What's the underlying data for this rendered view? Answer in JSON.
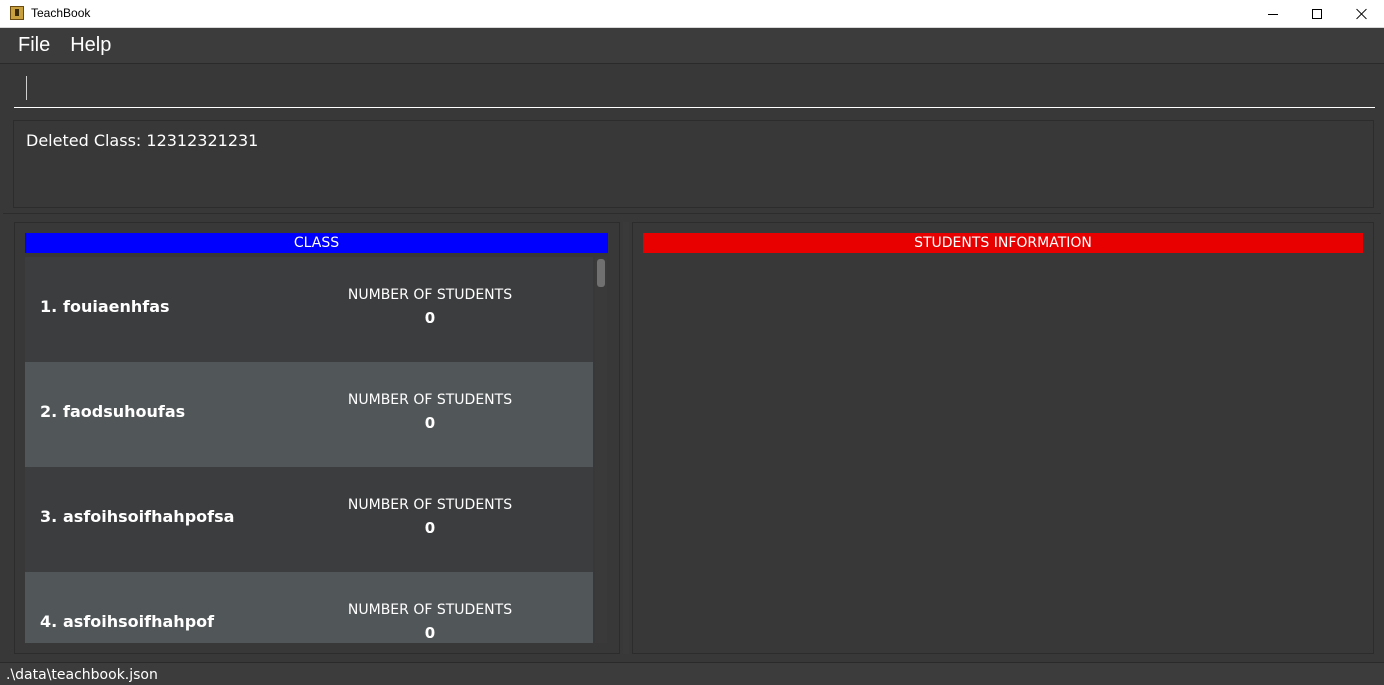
{
  "window": {
    "title": "TeachBook"
  },
  "menu": {
    "items": [
      {
        "label": "File"
      },
      {
        "label": "Help"
      }
    ]
  },
  "command": {
    "value": "",
    "placeholder": ""
  },
  "result": {
    "text": "Deleted Class: 12312321231"
  },
  "class_panel": {
    "header": "CLASS",
    "header_color": "#0000ff",
    "rows": [
      {
        "index": "1.",
        "name": "fouiaenhfas",
        "label": "NUMBER OF STUDENTS",
        "count": "0"
      },
      {
        "index": "2.",
        "name": "faodsuhoufas",
        "label": "NUMBER OF STUDENTS",
        "count": "0"
      },
      {
        "index": "3.",
        "name": "asfoihsoifhahpofsa",
        "label": "NUMBER OF STUDENTS",
        "count": "0"
      },
      {
        "index": "4.",
        "name": "asfoihsoifhahpof",
        "label": "NUMBER OF STUDENTS",
        "count": "0"
      }
    ]
  },
  "students_panel": {
    "header": "STUDENTS INFORMATION",
    "header_color": "#e80000"
  },
  "status": {
    "path": ".\\data\\teachbook.json"
  }
}
